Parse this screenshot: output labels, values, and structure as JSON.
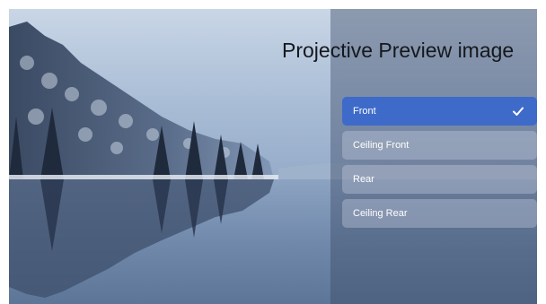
{
  "panel": {
    "title": "Projective Preview image",
    "options": [
      {
        "label": "Front",
        "selected": true
      },
      {
        "label": "Ceiling Front",
        "selected": false
      },
      {
        "label": "Rear",
        "selected": false
      },
      {
        "label": "Ceiling Rear",
        "selected": false
      }
    ],
    "selected_icon": "checkmark-icon"
  },
  "colors": {
    "selected_bg": "#3e6bc9",
    "option_text": "#ffffff",
    "title_text": "#15181d"
  }
}
